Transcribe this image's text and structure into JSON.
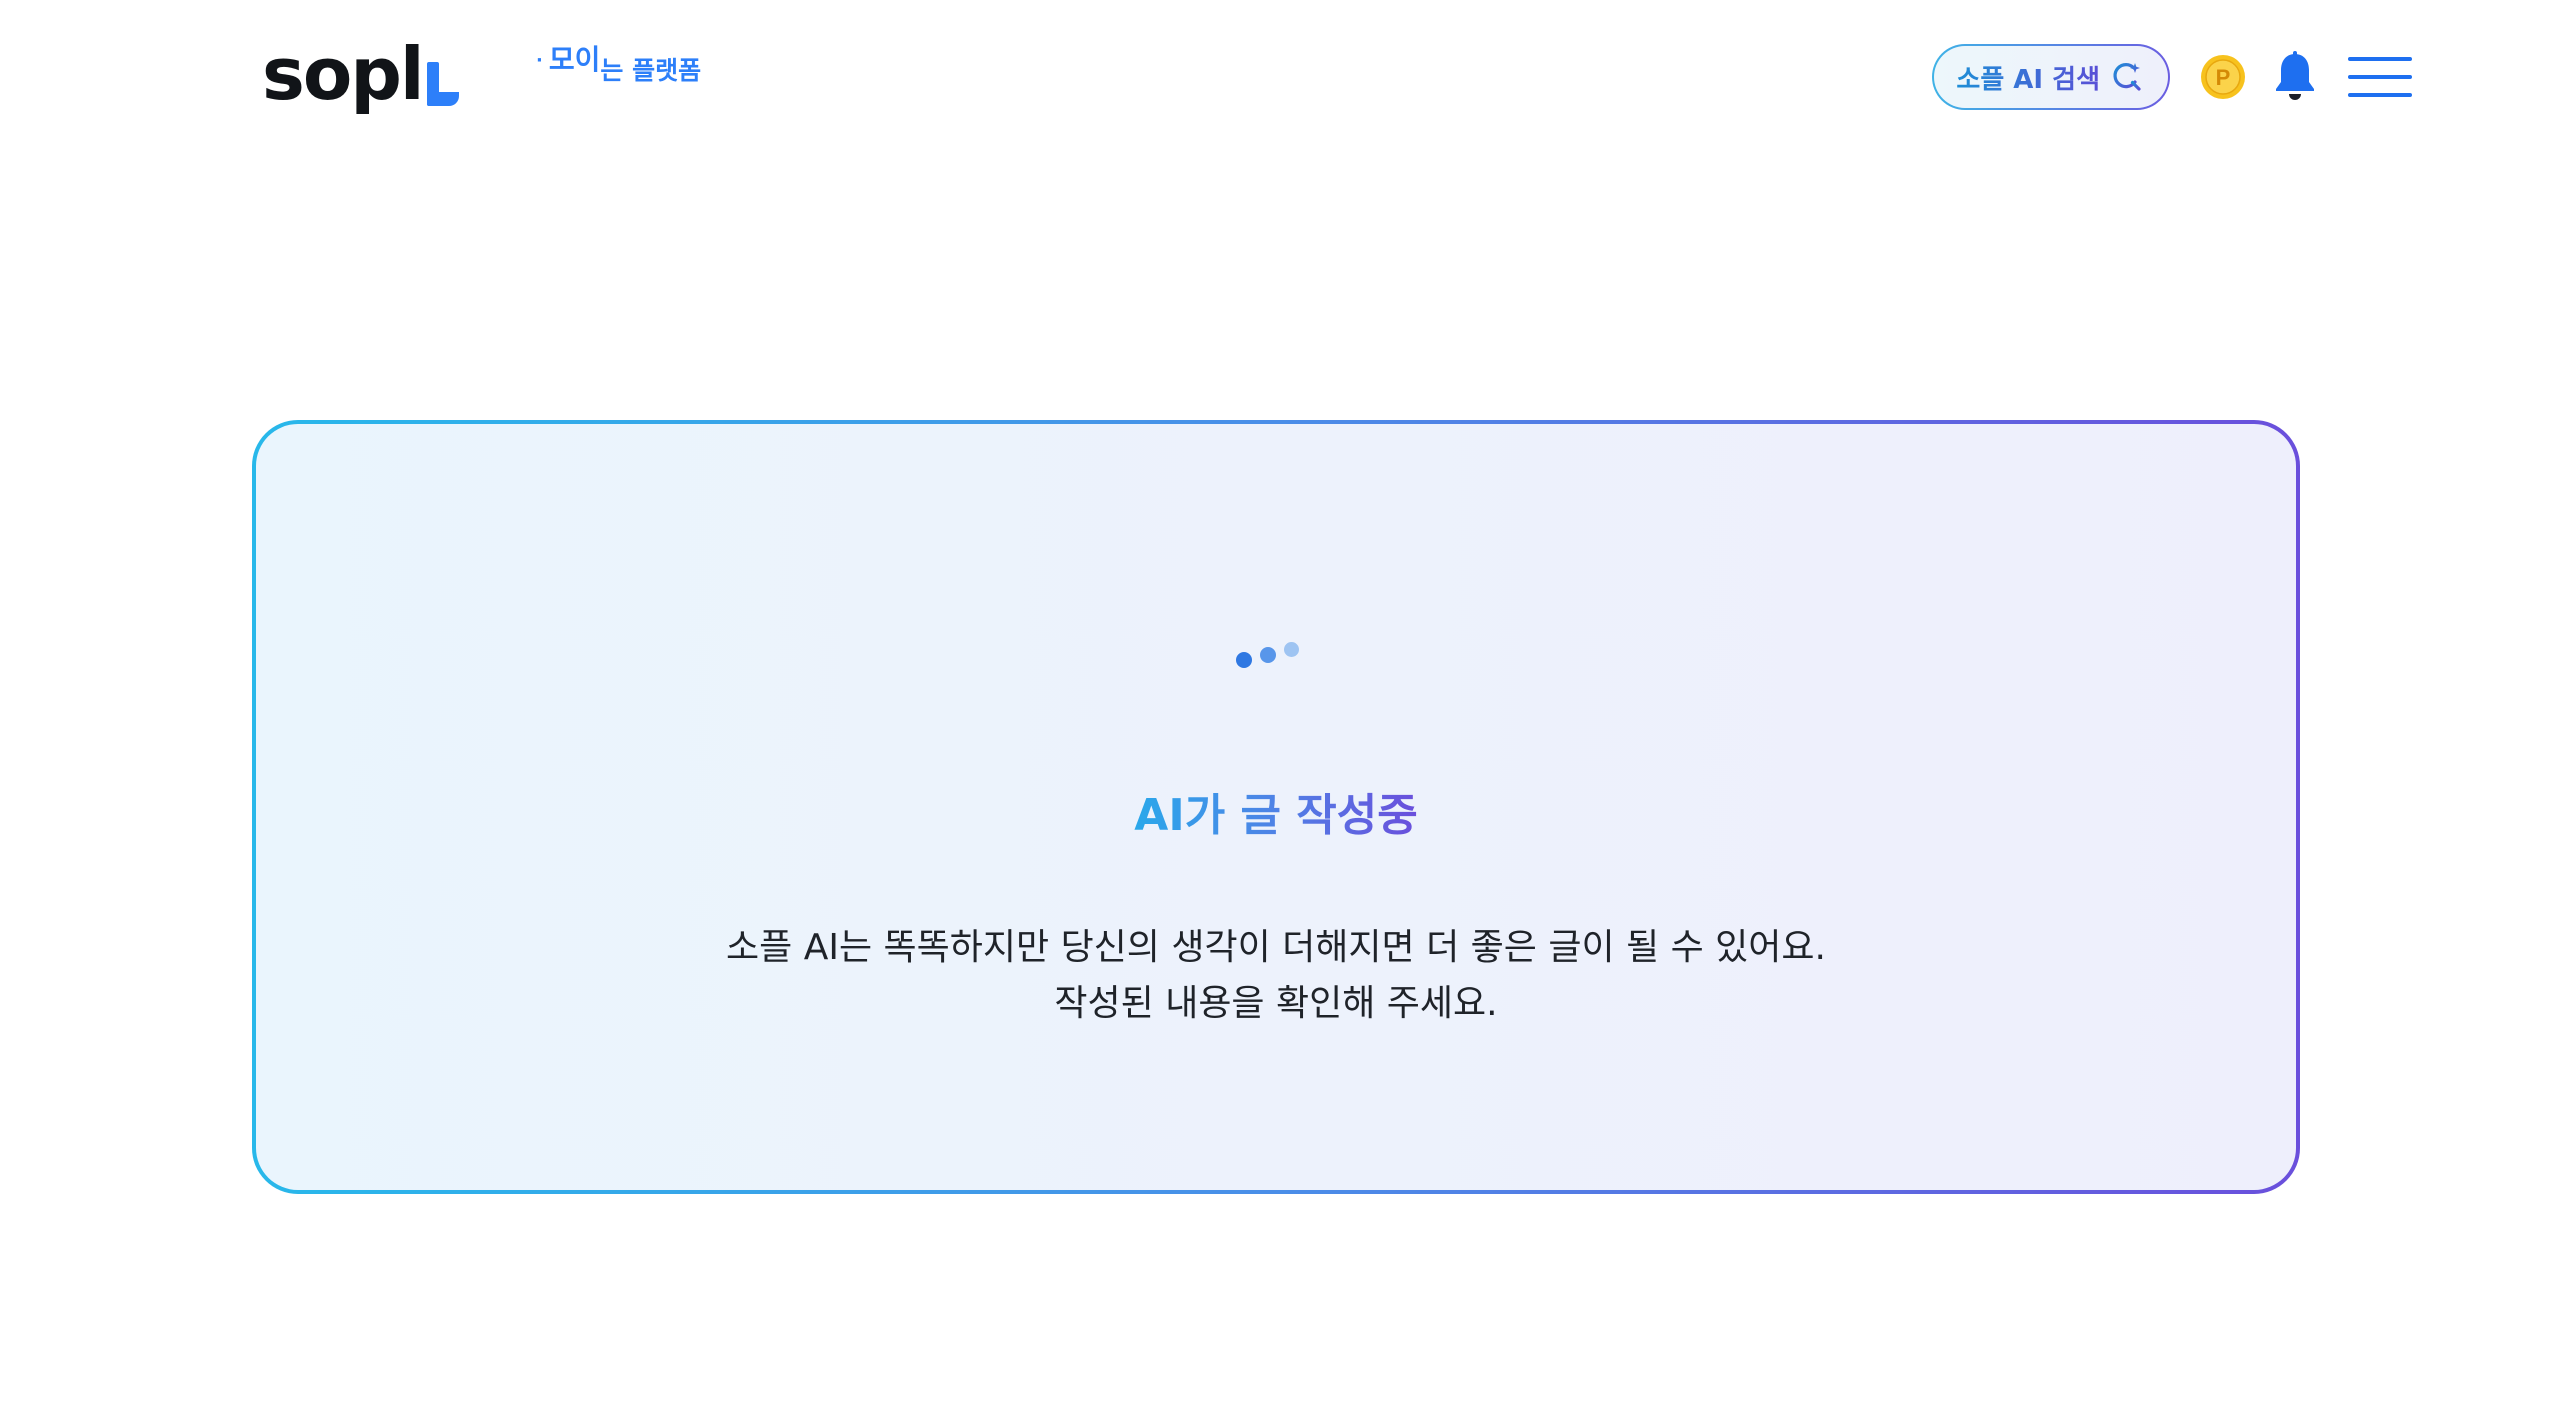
{
  "header": {
    "logo_text": "sopl",
    "tagline_dot": "·",
    "tagline_part1": "모이",
    "tagline_part2": "는 플랫폼",
    "ai_search_label": "소플 AI 검색",
    "point_icon_letter": "P"
  },
  "card": {
    "title": "AI가 글 작성중",
    "desc_line1": "소플 AI는 똑똑하지만 당신의 생각이 더해지면 더 좋은 글이 될 수 있어요.",
    "desc_line2": "작성된 내용을 확인해 주세요."
  },
  "colors": {
    "brand_blue": "#2d7ff9",
    "gradient_start": "#28b8ea",
    "gradient_end": "#6a4fdc",
    "coin": "#f7c21d",
    "bell": "#1e6ff0"
  }
}
